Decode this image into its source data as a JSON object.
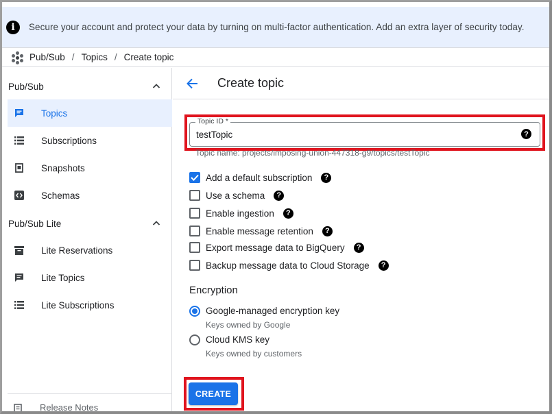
{
  "banner": {
    "message": "Secure your account and protect your data by turning on multi-factor authentication. Add an extra layer of security today."
  },
  "breadcrumb": {
    "items": [
      "Pub/Sub",
      "Topics",
      "Create topic"
    ]
  },
  "sidebar": {
    "section1": {
      "title": "Pub/Sub",
      "items": [
        {
          "label": "Topics",
          "icon": "topic-icon",
          "active": true
        },
        {
          "label": "Subscriptions",
          "icon": "list-icon"
        },
        {
          "label": "Snapshots",
          "icon": "snapshot-icon"
        },
        {
          "label": "Schemas",
          "icon": "schema-icon"
        }
      ]
    },
    "section2": {
      "title": "Pub/Sub Lite",
      "items": [
        {
          "label": "Lite Reservations",
          "icon": "reservation-icon"
        },
        {
          "label": "Lite Topics",
          "icon": "topic-icon"
        },
        {
          "label": "Lite Subscriptions",
          "icon": "list-icon"
        }
      ]
    },
    "bottom": {
      "label": "Release Notes"
    }
  },
  "main": {
    "title": "Create topic",
    "topic_id": {
      "label": "Topic ID *",
      "value": "testTopic"
    },
    "hint": "Topic name: projects/imposing-union-447318-g9/topics/testTopic",
    "options": [
      {
        "label": "Add a default subscription",
        "checked": true
      },
      {
        "label": "Use a schema",
        "checked": false
      },
      {
        "label": "Enable ingestion",
        "checked": false
      },
      {
        "label": "Enable message retention",
        "checked": false
      },
      {
        "label": "Export message data to BigQuery",
        "checked": false
      },
      {
        "label": "Backup message data to Cloud Storage",
        "checked": false
      }
    ],
    "encryption": {
      "title": "Encryption",
      "options": [
        {
          "label": "Google-managed encryption key",
          "sub": "Keys owned by Google",
          "selected": true
        },
        {
          "label": "Cloud KMS key",
          "sub": "Keys owned by customers",
          "selected": false
        }
      ]
    },
    "create_label": "CREATE"
  },
  "colors": {
    "accent": "#1a73e8",
    "highlight_box": "#e0141e",
    "banner_bg": "#e8f0fe"
  }
}
